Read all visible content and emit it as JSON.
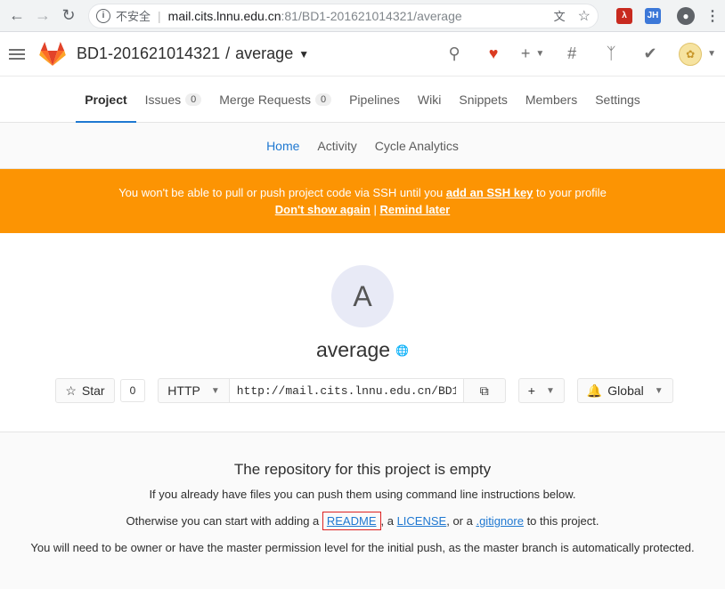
{
  "browser": {
    "insecure_label": "不安全",
    "url_host": "mail.cits.lnnu.edu.cn",
    "url_rest": ":81/BD1-201621014321/average",
    "ext_jh": "JH"
  },
  "header": {
    "namespace": "BD1-201621014321",
    "separator": "/",
    "project": "average"
  },
  "project_nav": {
    "tabs": [
      {
        "label": "Project"
      },
      {
        "label": "Issues",
        "count": "0"
      },
      {
        "label": "Merge Requests",
        "count": "0"
      },
      {
        "label": "Pipelines"
      },
      {
        "label": "Wiki"
      },
      {
        "label": "Snippets"
      },
      {
        "label": "Members"
      },
      {
        "label": "Settings"
      }
    ]
  },
  "sub_nav": {
    "items": [
      {
        "label": "Home"
      },
      {
        "label": "Activity"
      },
      {
        "label": "Cycle Analytics"
      }
    ]
  },
  "alert": {
    "text_before": "You won't be able to pull or push project code via SSH until you ",
    "link_ssh": "add an SSH key",
    "text_after": " to your profile",
    "dont_show": "Don't show again",
    "divider": "|",
    "remind_later": "Remind later"
  },
  "project": {
    "avatar_letter": "A",
    "name": "average",
    "star_label": "Star",
    "star_count": "0",
    "protocol": "HTTP",
    "clone_url": "http://mail.cits.lnnu.edu.cn/BD1",
    "visibility_label": "Global"
  },
  "empty_repo": {
    "title": "The repository for this project is empty",
    "line1": "If you already have files you can push them using command line instructions below.",
    "line2_before": "Otherwise you can start with adding a ",
    "readme": "README",
    "line2_mid1": ", a ",
    "license": "LICENSE",
    "line2_mid2": ", or a ",
    "gitignore": ".gitignore",
    "line2_after": " to this project.",
    "line3": "You will need to be owner or have the master permission level for the initial push, as the master branch is automatically protected."
  }
}
